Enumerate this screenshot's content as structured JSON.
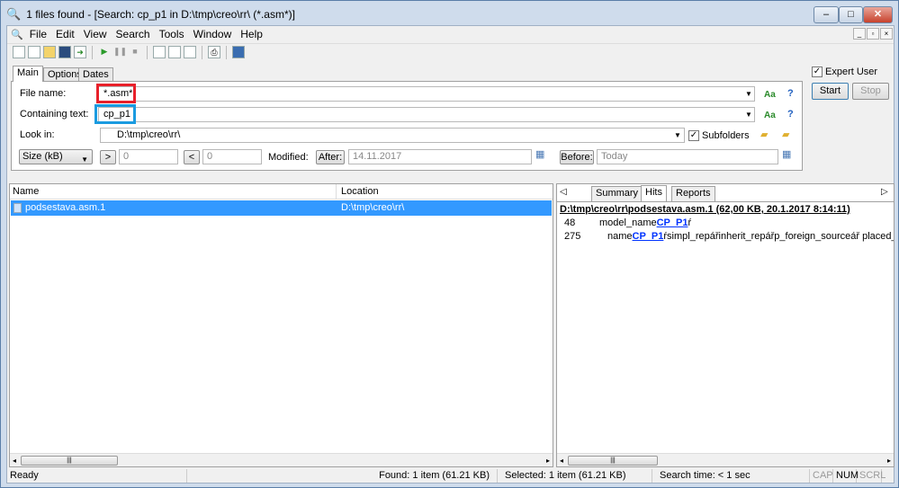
{
  "window": {
    "title": "1 files found - [Search: cp_p1 in D:\\tmp\\creo\\rr\\ (*.asm*)]",
    "buttons": {
      "minimize": "–",
      "maximize": "□",
      "close": "✕"
    }
  },
  "menu": [
    "File",
    "Edit",
    "View",
    "Search",
    "Tools",
    "Window",
    "Help"
  ],
  "mdi_buttons": [
    "_",
    "▫",
    "×"
  ],
  "tabs": [
    "Main",
    "Options",
    "Dates"
  ],
  "form": {
    "file_name_label": "File name:",
    "file_name_value": "*.asm*",
    "containing_text_label": "Containing text:",
    "containing_text_value": "cp_p1",
    "case_label": "Aa",
    "help_label": "?",
    "look_in_label": "Look in:",
    "look_in_value": "D:\\tmp\\creo\\rr\\",
    "subfolders_label": "Subfolders",
    "subfolders_checked": true,
    "size_select": "Size (kB)",
    "gt_label": ">",
    "gt_value": "0",
    "lt_label": "<",
    "lt_value": "0",
    "modified_label": "Modified:",
    "after_label": "After:",
    "after_value": "14.11.2017",
    "before_label": "Before:",
    "before_placeholder": "Today"
  },
  "side": {
    "expert_user_label": "Expert User",
    "expert_user_checked": true,
    "start_label": "Start",
    "stop_label": "Stop"
  },
  "highlight_colors": {
    "file_name": "#e8202a",
    "containing_text": "#1a9be0",
    "selection": "#3399ff"
  },
  "results": {
    "columns": [
      "Name",
      "Location"
    ],
    "rows": [
      {
        "name": "podsestava.asm.1",
        "location": "D:\\tmp\\creo\\rr\\"
      }
    ]
  },
  "details": {
    "tabs": [
      "Summary",
      "Hits",
      "Reports"
    ],
    "active_tab": "Hits",
    "file_header": "D:\\tmp\\creo\\rr\\podsestava.asm.1   (62,00 KB,  20.1.2017 8:14:11)",
    "hits": [
      {
        "line": "48",
        "pre": "model_name",
        "match": "CP_P1",
        "post": "ŕ"
      },
      {
        "line": "275",
        "pre": "name",
        "match": "CP_P1",
        "post": "ŕsimpl_repářinherit_repářp_foreign_sourceář placed_flag"
      }
    ]
  },
  "status": {
    "ready": "Ready",
    "found": "Found: 1 item (61.21 KB)",
    "selected": "Selected: 1 item (61.21 KB)",
    "search_time": "Search time: < 1 sec",
    "cap": "CAP",
    "num": "NUM",
    "scrl": "SCRL"
  }
}
